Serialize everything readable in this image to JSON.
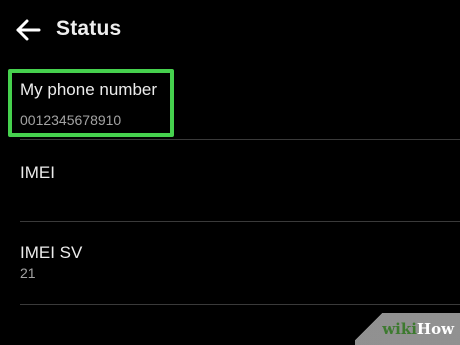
{
  "app_bar": {
    "back_icon": "arrow-left-icon",
    "title": "Status"
  },
  "items": [
    {
      "title": "My phone number",
      "value": "0012345678910"
    },
    {
      "title": "IMEI",
      "value": ""
    },
    {
      "title": "IMEI SV",
      "value": "21"
    }
  ],
  "highlight": {
    "color": "#46d14e"
  },
  "watermark": {
    "wiki": "wiki",
    "how": "How"
  }
}
